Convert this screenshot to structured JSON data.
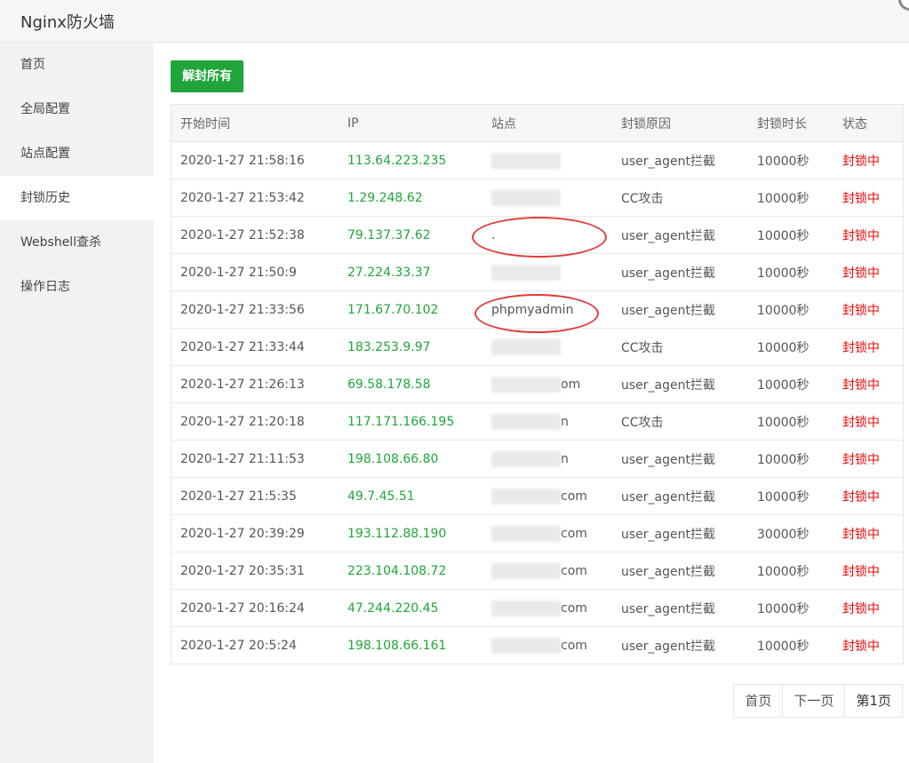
{
  "app": {
    "title": "Nginx防火墙"
  },
  "sidebar": {
    "items": [
      {
        "label": "首页",
        "active": false
      },
      {
        "label": "全局配置",
        "active": false
      },
      {
        "label": "站点配置",
        "active": false
      },
      {
        "label": "封锁历史",
        "active": true
      },
      {
        "label": "Webshell查杀",
        "active": false
      },
      {
        "label": "操作日志",
        "active": false
      }
    ]
  },
  "toolbar": {
    "unblock_all_label": "解封所有"
  },
  "table": {
    "headers": [
      "开始时间",
      "IP",
      "站点",
      "封锁原因",
      "封锁时长",
      "状态"
    ],
    "rows": [
      {
        "time": "2020-1-27 21:58:16",
        "ip": "113.64.223.235",
        "site": "",
        "reason": "user_agent拦截",
        "duration": "10000秒",
        "status": "封锁中"
      },
      {
        "time": "2020-1-27 21:53:42",
        "ip": "1.29.248.62",
        "site": "",
        "reason": "CC攻击",
        "duration": "10000秒",
        "status": "封锁中"
      },
      {
        "time": "2020-1-27 21:52:38",
        "ip": "79.137.37.62",
        "site": ".",
        "reason": "user_agent拦截",
        "duration": "10000秒",
        "status": "封锁中"
      },
      {
        "time": "2020-1-27 21:50:9",
        "ip": "27.224.33.37",
        "site": "",
        "reason": "user_agent拦截",
        "duration": "10000秒",
        "status": "封锁中"
      },
      {
        "time": "2020-1-27 21:33:56",
        "ip": "171.67.70.102",
        "site": "phpmyadmin",
        "reason": "user_agent拦截",
        "duration": "10000秒",
        "status": "封锁中"
      },
      {
        "time": "2020-1-27 21:33:44",
        "ip": "183.253.9.97",
        "site": "",
        "reason": "CC攻击",
        "duration": "10000秒",
        "status": "封锁中"
      },
      {
        "time": "2020-1-27 21:26:13",
        "ip": "69.58.178.58",
        "site": "om",
        "reason": "user_agent拦截",
        "duration": "10000秒",
        "status": "封锁中"
      },
      {
        "time": "2020-1-27 21:20:18",
        "ip": "117.171.166.195",
        "site": "n",
        "reason": "CC攻击",
        "duration": "10000秒",
        "status": "封锁中"
      },
      {
        "time": "2020-1-27 21:11:53",
        "ip": "198.108.66.80",
        "site": "n",
        "reason": "user_agent拦截",
        "duration": "10000秒",
        "status": "封锁中"
      },
      {
        "time": "2020-1-27 21:5:35",
        "ip": "49.7.45.51",
        "site": "com",
        "reason": "user_agent拦截",
        "duration": "10000秒",
        "status": "封锁中"
      },
      {
        "time": "2020-1-27 20:39:29",
        "ip": "193.112.88.190",
        "site": "com",
        "reason": "user_agent拦截",
        "duration": "30000秒",
        "status": "封锁中"
      },
      {
        "time": "2020-1-27 20:35:31",
        "ip": "223.104.108.72",
        "site": "com",
        "reason": "user_agent拦截",
        "duration": "10000秒",
        "status": "封锁中"
      },
      {
        "time": "2020-1-27 20:16:24",
        "ip": "47.244.220.45",
        "site": "com",
        "reason": "user_agent拦截",
        "duration": "10000秒",
        "status": "封锁中"
      },
      {
        "time": "2020-1-27 20:5:24",
        "ip": "198.108.66.161",
        "site": "com",
        "reason": "user_agent拦截",
        "duration": "10000秒",
        "status": "封锁中"
      }
    ]
  },
  "pagination": {
    "first": "首页",
    "next": "下一页",
    "current": "第1页"
  },
  "colors": {
    "accent_green": "#20a53a",
    "status_red": "#ef0808",
    "highlight_red": "#e23b3b"
  }
}
